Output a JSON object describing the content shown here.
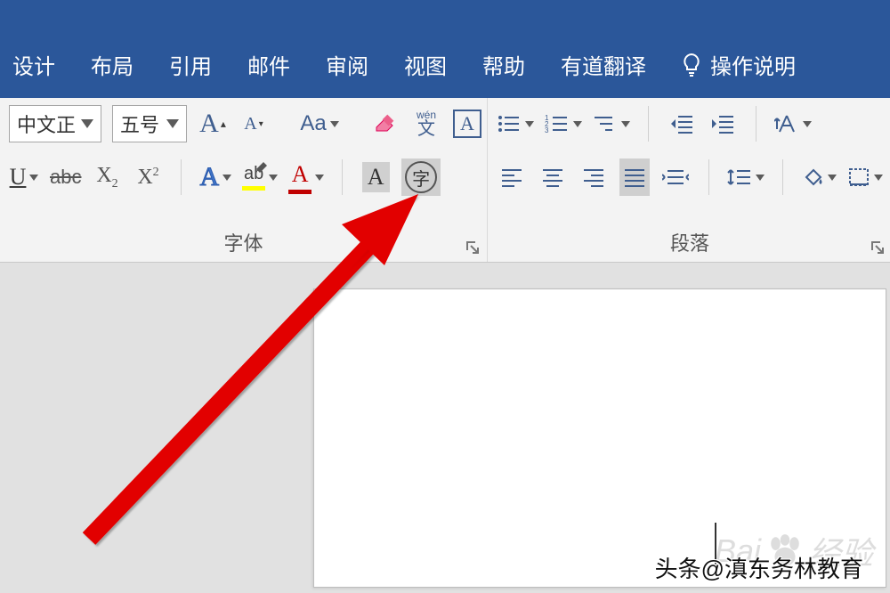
{
  "tabs": {
    "design": "设计",
    "layout": "布局",
    "references": "引用",
    "mailings": "邮件",
    "review": "审阅",
    "view": "视图",
    "help": "帮助",
    "youdao": "有道翻译",
    "tellme": "操作说明"
  },
  "font": {
    "name": "中文正",
    "size": "五号",
    "group_label": "字体",
    "increase_a": "A",
    "decrease_a": "A",
    "change_case": "Aa",
    "phonetic_top": "wén",
    "phonetic_char": "文",
    "char_border": "A",
    "underline": "U",
    "strike": "abc",
    "subscript": "X",
    "subscript_s": "2",
    "superscript": "X",
    "superscript_s": "2",
    "texteffects": "A",
    "highlight_ab": "ab",
    "fontcolor": "A",
    "shading": "A",
    "enclose": "字"
  },
  "paragraph": {
    "group_label": "段落",
    "style_a": "A"
  },
  "watermark": {
    "brand": "Bai",
    "brand2": "经验"
  },
  "credit": "头条@滇东务林教育"
}
